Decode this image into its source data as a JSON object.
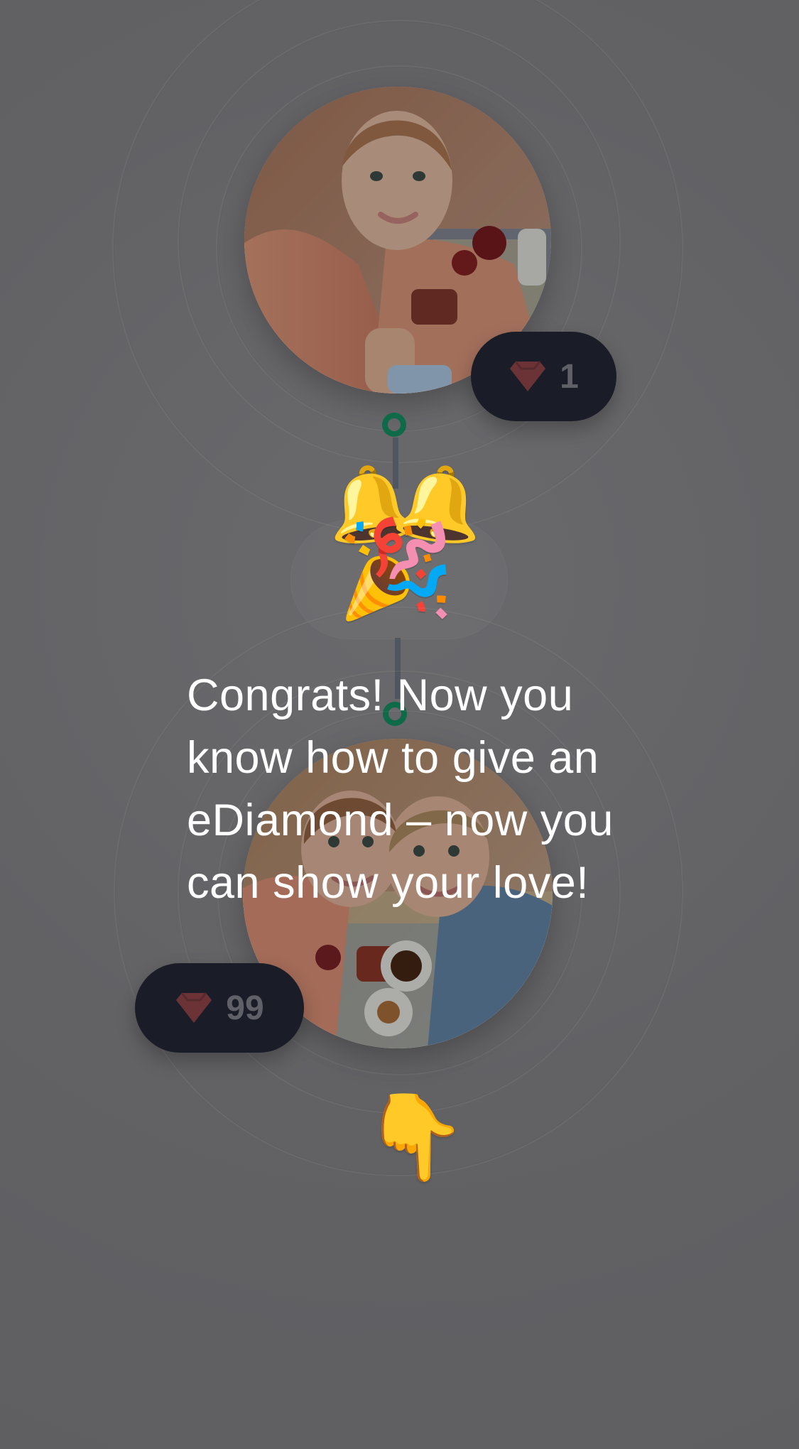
{
  "screen": {
    "background_color": "#626265"
  },
  "top_profile": {
    "diamond_count": "1",
    "badge_color": "#1a1d27",
    "gem_color": "#8c3c3d"
  },
  "celebration": {
    "bells_icon": "🔔",
    "confetti_icon": "🎉"
  },
  "message": {
    "text": "Congrats! Now you know how to give an eDiamond – now you can show your love!"
  },
  "bottom_profile": {
    "diamond_count": "99",
    "badge_color": "#1a1d27",
    "gem_color": "#8c3c3d"
  },
  "pointer": {
    "icon": "👇"
  }
}
